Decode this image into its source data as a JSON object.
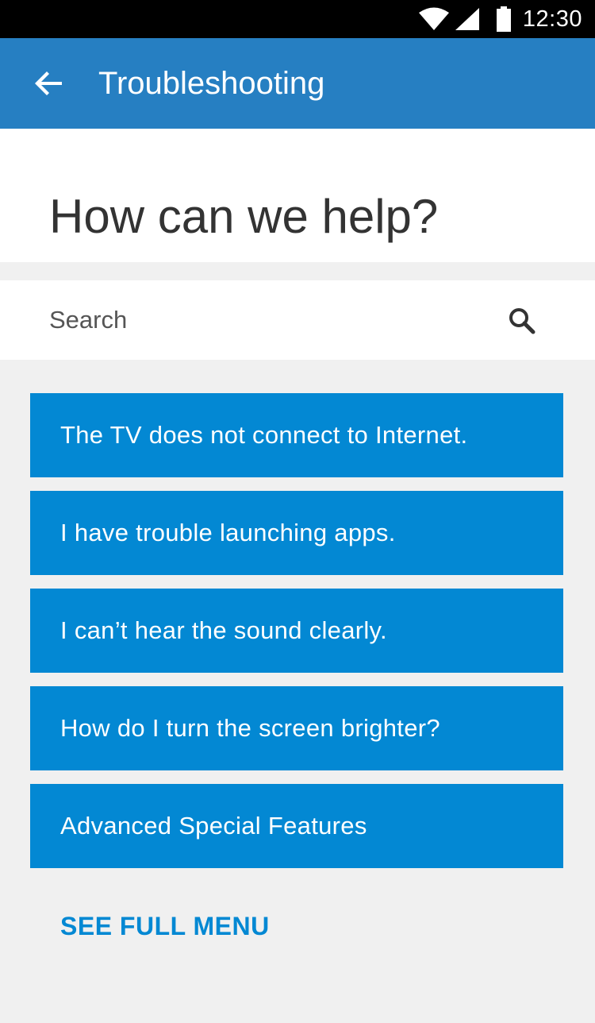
{
  "status_bar": {
    "time": "12:30",
    "icons": [
      "wifi-icon",
      "signal-icon",
      "battery-icon"
    ]
  },
  "app_bar": {
    "title": "Troubleshooting",
    "back_icon": "arrow-left-icon"
  },
  "header": {
    "title": "How can we help?"
  },
  "search": {
    "placeholder": "Search",
    "icon": "search-icon"
  },
  "topics": [
    {
      "label": "The TV does not connect to Internet."
    },
    {
      "label": "I have trouble launching apps."
    },
    {
      "label": "I can’t hear the sound clearly."
    },
    {
      "label": "How do I turn the screen brighter?"
    },
    {
      "label": "Advanced Special Features"
    }
  ],
  "see_full_menu": "SEE FULL MENU",
  "colors": {
    "app_bar": "#267fc2",
    "accent": "#0388d3",
    "background": "#f0f0f0",
    "status_bar": "#000000"
  }
}
